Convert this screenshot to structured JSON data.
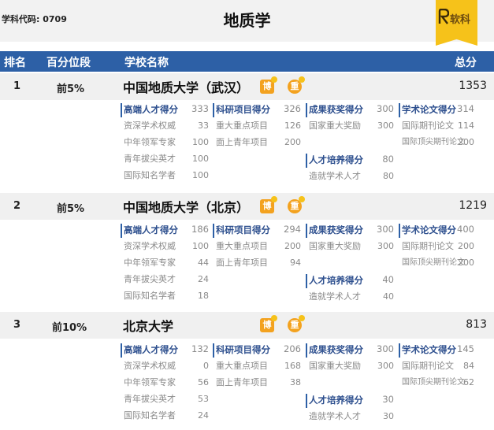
{
  "header": {
    "code_label": "学科代码:",
    "code_value": "0709",
    "title": "地质学",
    "brand": "软科"
  },
  "columns": {
    "rank": "排名",
    "percentile": "百分位段",
    "school": "学校名称",
    "total": "总分"
  },
  "badges": {
    "bo": "博",
    "zhong": "重"
  },
  "schools": [
    {
      "rank": "1",
      "percentile": "前5%",
      "name": "中国地质大学（武汉）",
      "total": "1353",
      "talent": {
        "label": "高端人才得分",
        "value": "333",
        "items": [
          {
            "label": "资深学术权威",
            "value": "33"
          },
          {
            "label": "中年领军专家",
            "value": "100"
          },
          {
            "label": "青年拔尖英才",
            "value": "100"
          },
          {
            "label": "国际知名学者",
            "value": "100"
          }
        ]
      },
      "research": {
        "label": "科研项目得分",
        "value": "326",
        "items": [
          {
            "label": "重大重点项目",
            "value": "126"
          },
          {
            "label": "面上青年项目",
            "value": "200"
          }
        ]
      },
      "award": {
        "label": "成果获奖得分",
        "value": "300",
        "items": [
          {
            "label": "国家重大奖励",
            "value": "300"
          }
        ]
      },
      "training": {
        "label": "人才培养得分",
        "value": "80",
        "items": [
          {
            "label": "造就学术人才",
            "value": "80"
          }
        ]
      },
      "paper": {
        "label": "学术论文得分",
        "value": "314",
        "items": [
          {
            "label": "国际期刊论文",
            "value": "114"
          },
          {
            "label": "国际顶尖期刊论文",
            "value": "200"
          }
        ]
      }
    },
    {
      "rank": "2",
      "percentile": "前5%",
      "name": "中国地质大学（北京）",
      "total": "1219",
      "talent": {
        "label": "高端人才得分",
        "value": "186",
        "items": [
          {
            "label": "资深学术权威",
            "value": "100"
          },
          {
            "label": "中年领军专家",
            "value": "44"
          },
          {
            "label": "青年拔尖英才",
            "value": "24"
          },
          {
            "label": "国际知名学者",
            "value": "18"
          }
        ]
      },
      "research": {
        "label": "科研项目得分",
        "value": "294",
        "items": [
          {
            "label": "重大重点项目",
            "value": "200"
          },
          {
            "label": "面上青年项目",
            "value": "94"
          }
        ]
      },
      "award": {
        "label": "成果获奖得分",
        "value": "300",
        "items": [
          {
            "label": "国家重大奖励",
            "value": "300"
          }
        ]
      },
      "training": {
        "label": "人才培养得分",
        "value": "40",
        "items": [
          {
            "label": "造就学术人才",
            "value": "40"
          }
        ]
      },
      "paper": {
        "label": "学术论文得分",
        "value": "400",
        "items": [
          {
            "label": "国际期刊论文",
            "value": "200"
          },
          {
            "label": "国际顶尖期刊论文",
            "value": "200"
          }
        ]
      }
    },
    {
      "rank": "3",
      "percentile": "前10%",
      "name": "北京大学",
      "total": "813",
      "talent": {
        "label": "高端人才得分",
        "value": "132",
        "items": [
          {
            "label": "资深学术权威",
            "value": "0"
          },
          {
            "label": "中年领军专家",
            "value": "56"
          },
          {
            "label": "青年拔尖英才",
            "value": "53"
          },
          {
            "label": "国际知名学者",
            "value": "24"
          }
        ]
      },
      "research": {
        "label": "科研项目得分",
        "value": "206",
        "items": [
          {
            "label": "重大重点项目",
            "value": "168"
          },
          {
            "label": "面上青年项目",
            "value": "38"
          }
        ]
      },
      "award": {
        "label": "成果获奖得分",
        "value": "300",
        "items": [
          {
            "label": "国家重大奖励",
            "value": "300"
          }
        ]
      },
      "training": {
        "label": "人才培养得分",
        "value": "30",
        "items": [
          {
            "label": "造就学术人才",
            "value": "30"
          }
        ]
      },
      "paper": {
        "label": "学术论文得分",
        "value": "145",
        "items": [
          {
            "label": "国际期刊论文",
            "value": "84"
          },
          {
            "label": "国际顶尖期刊论文",
            "value": "62"
          }
        ]
      }
    }
  ]
}
